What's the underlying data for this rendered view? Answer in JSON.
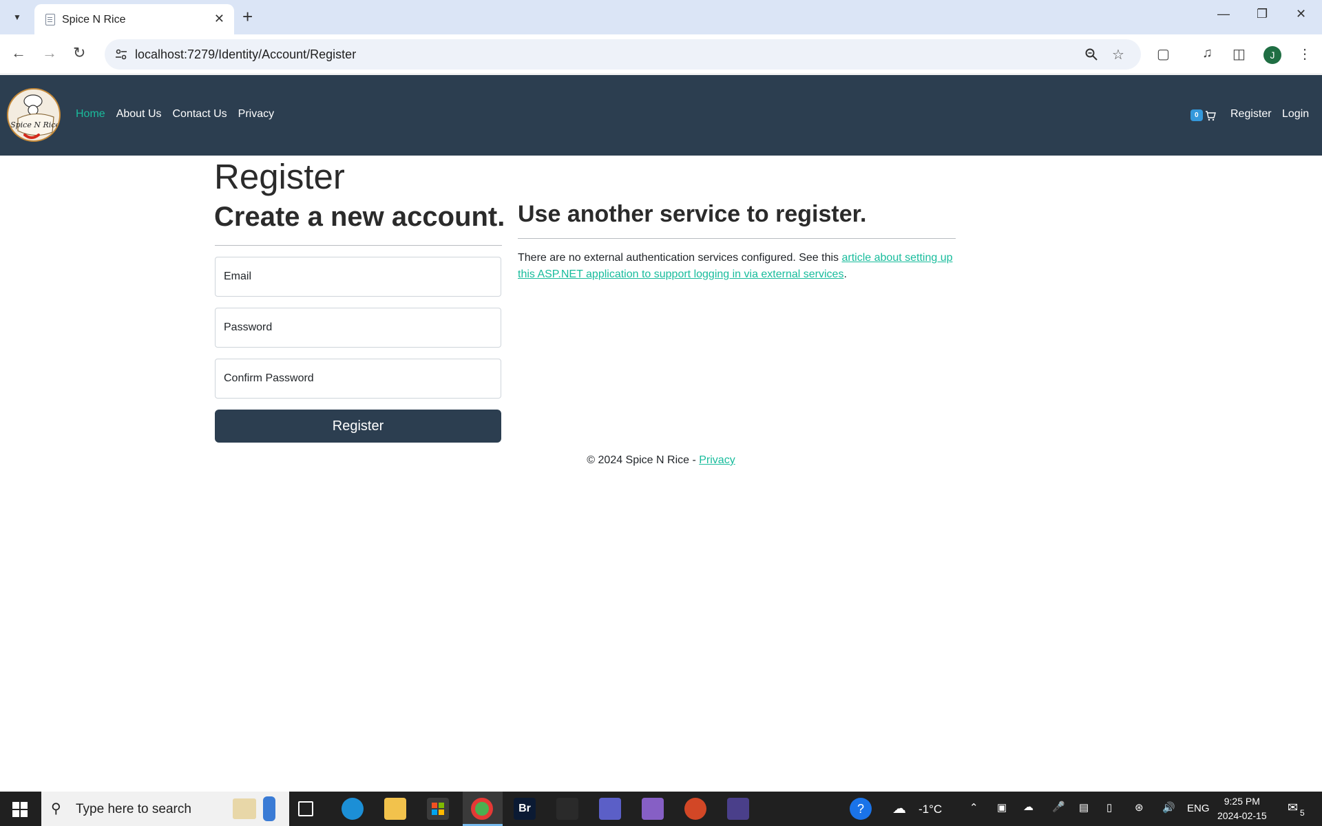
{
  "browser": {
    "tab_title": "Spice N Rice",
    "url": "localhost:7279/Identity/Account/Register",
    "profile_initial": "J"
  },
  "navbar": {
    "links": [
      "Home",
      "About Us",
      "Contact Us",
      "Privacy"
    ],
    "active_link": "Home",
    "cart_count": "0",
    "register": "Register",
    "login": "Login",
    "logo_text": "Spice N Rice"
  },
  "page": {
    "title": "Register",
    "subtitle": "Create a new account.",
    "fields": {
      "email": "Email",
      "password": "Password",
      "confirm_password": "Confirm Password"
    },
    "register_button": "Register",
    "external": {
      "heading": "Use another service to register.",
      "text_before": "There are no external authentication services configured. See this ",
      "link_text": "article about setting up this ASP.NET application to support logging in via external services",
      "text_after": "."
    }
  },
  "footer": {
    "copyright": "© 2024 Spice N Rice - ",
    "privacy": "Privacy"
  },
  "taskbar": {
    "search_placeholder": "Type here to search",
    "weather": "-1°C",
    "language": "ENG",
    "time": "9:25 PM",
    "date": "2024-02-15",
    "notifications": "5"
  },
  "colors": {
    "navbar_bg": "#2c3e50",
    "accent": "#18bc9c",
    "badge": "#3498db"
  }
}
